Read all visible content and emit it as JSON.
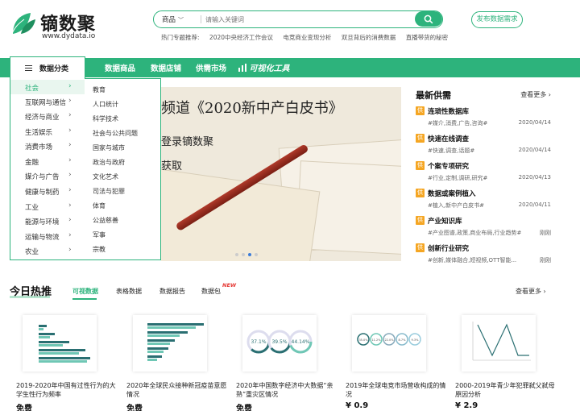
{
  "brand": {
    "name": "镝数聚",
    "url": "www.dydata.io"
  },
  "search": {
    "category": "商品",
    "placeholder": "请输入关键词"
  },
  "hot_topics": {
    "label": "热门专题推荐:",
    "items": [
      "2020中央经济工作会议",
      "电竞商业变现分析",
      "双旦背后的消费数据",
      "直播带货的秘密"
    ]
  },
  "publish_button": "发布数据需求",
  "nav": {
    "category_label": "数据分类",
    "items": [
      "数据商品",
      "数据店铺",
      "供需市场"
    ],
    "viz": "可视化工具"
  },
  "categories": [
    "社会",
    "互联网与通信",
    "经济与商业",
    "生活娱乐",
    "消费市场",
    "金融",
    "媒介与广告",
    "健康与制药",
    "工业",
    "能源与环境",
    "运输与物流",
    "农业"
  ],
  "subcategories": [
    "教育",
    "人口统计",
    "科学技术",
    "社会与公共问题",
    "国家与城市",
    "政治与政府",
    "文化艺术",
    "司法与犯罪",
    "体育",
    "公益慈善",
    "军事",
    "宗教"
  ],
  "banner": {
    "line1": "频道《2020新中产白皮书》",
    "line2": "登录镝数聚",
    "line3": "获取"
  },
  "supply": {
    "title": "最新供需",
    "more": "查看更多 ›",
    "badge": "供",
    "items": [
      {
        "title": "连琐性数据库",
        "tags": "#媒介,消费,广告,咨询#",
        "date": "2020/04/14"
      },
      {
        "title": "快速在线调查",
        "tags": "#快速,调查,话题#",
        "date": "2020/04/14"
      },
      {
        "title": "个案专项研究",
        "tags": "#行业,定制,调研,研究#",
        "date": "2020/04/13"
      },
      {
        "title": "数据或案例植入",
        "tags": "#植入,新中产白皮书#",
        "date": "2020/04/11"
      },
      {
        "title": "产业知识库",
        "tags": "#产业图谱,政策,商业布局,行业趋势#",
        "date": "刚刚"
      },
      {
        "title": "创新行业研究",
        "tags": "#创新,媒体融合,短视频,OTT智能...",
        "date": "刚刚"
      }
    ]
  },
  "today_hot": {
    "title": "今日热推",
    "tabs": [
      "可视数据",
      "表格数据",
      "数据报告",
      "数据包"
    ],
    "new_badge": "NEW",
    "more": "查看更多 ›",
    "cards": [
      {
        "title": "2019-2020年中国有过性行为的大学生性行为频率",
        "price": "免费"
      },
      {
        "title": "2020年全球民众接种新冠疫苗意愿情况",
        "price": "免费"
      },
      {
        "title": "2020年中国数字经济中大数据“亲熟”重灾区情况",
        "price": "免费"
      },
      {
        "title": "2019年全球电竞市场营收构成的情况",
        "price": "¥ 0.9"
      },
      {
        "title": "2000-2019年青少年犯罪弑父弑母原因分析",
        "price": "¥ 2.9"
      }
    ],
    "thumb_circles": [
      "37.1%",
      "39.5%",
      "44.14%"
    ],
    "thumb_small_circles": [
      "35.0%",
      "11.2%",
      "22.0%",
      "8.7%",
      "9.3%"
    ]
  },
  "colors": {
    "brand_green": "#2db37c",
    "supply_badge": "#f5a623",
    "new_red": "#e53935"
  }
}
